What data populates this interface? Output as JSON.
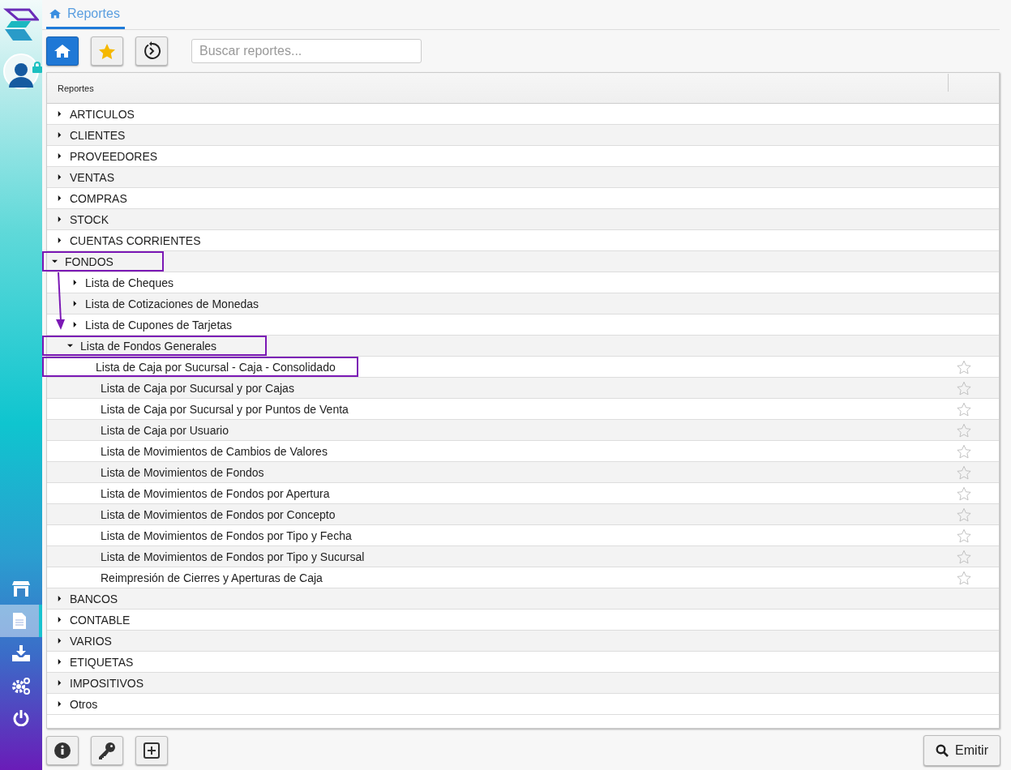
{
  "sidebar": {
    "items": [
      {
        "kind": "store",
        "selected": false
      },
      {
        "kind": "document",
        "selected": true
      },
      {
        "kind": "download",
        "selected": false
      },
      {
        "kind": "gears",
        "selected": false
      },
      {
        "kind": "power",
        "selected": false
      }
    ]
  },
  "tabs": [
    {
      "label": "Reportes",
      "selected": true
    }
  ],
  "toolbar": {
    "buttons": [
      {
        "kind": "home",
        "selected": true
      },
      {
        "kind": "star",
        "selected": false
      },
      {
        "kind": "history",
        "selected": false
      }
    ],
    "search": {
      "placeholder": "Buscar reportes..."
    }
  },
  "table": {
    "columns": [
      "Reportes"
    ],
    "annotation_arrow": true,
    "rows": [
      {
        "label": "ARTICULOS",
        "expanded": false,
        "highlighted": false
      },
      {
        "label": "CLIENTES",
        "expanded": false,
        "highlighted": false
      },
      {
        "label": "PROVEEDORES",
        "expanded": false,
        "highlighted": false
      },
      {
        "label": "VENTAS",
        "expanded": false,
        "highlighted": false
      },
      {
        "label": "COMPRAS",
        "expanded": false,
        "highlighted": false
      },
      {
        "label": "STOCK",
        "expanded": false,
        "highlighted": false
      },
      {
        "label": "CUENTAS CORRIENTES",
        "expanded": false,
        "highlighted": false
      },
      {
        "label": "FONDOS",
        "expanded": true,
        "highlighted": true,
        "children": [
          {
            "label": "Lista de Cheques",
            "expanded": false,
            "highlighted": false
          },
          {
            "label": "Lista de Cotizaciones de Monedas",
            "expanded": false,
            "highlighted": false
          },
          {
            "label": "Lista de Cupones de Tarjetas",
            "expanded": false,
            "highlighted": false
          },
          {
            "label": "Lista de Fondos Generales",
            "expanded": true,
            "highlighted": true,
            "children": [
              {
                "label": "Lista de Caja por Sucursal - Caja - Consolidado",
                "favorite": false,
                "highlighted": true
              },
              {
                "label": "Lista de Caja por Sucursal y por Cajas",
                "favorite": false,
                "highlighted": false
              },
              {
                "label": "Lista de Caja por Sucursal y por Puntos de Venta",
                "favorite": false,
                "highlighted": false
              },
              {
                "label": "Lista de Caja por Usuario",
                "favorite": false,
                "highlighted": false
              },
              {
                "label": "Lista de Movimientos de Cambios de Valores",
                "favorite": false,
                "highlighted": false
              },
              {
                "label": "Lista de Movimientos de Fondos",
                "favorite": false,
                "highlighted": false
              },
              {
                "label": "Lista de Movimientos de Fondos por Apertura",
                "favorite": false,
                "highlighted": false
              },
              {
                "label": "Lista de Movimientos de Fondos por Concepto",
                "favorite": false,
                "highlighted": false
              },
              {
                "label": "Lista de Movimientos de Fondos por Tipo y Fecha",
                "favorite": false,
                "highlighted": false
              },
              {
                "label": "Lista de Movimientos de Fondos por Tipo y Sucursal",
                "favorite": false,
                "highlighted": false
              },
              {
                "label": "Reimpresión de Cierres y Aperturas de Caja",
                "favorite": false,
                "highlighted": false
              }
            ]
          }
        ]
      },
      {
        "label": "BANCOS",
        "expanded": false,
        "highlighted": false
      },
      {
        "label": "CONTABLE",
        "expanded": false,
        "highlighted": false
      },
      {
        "label": "VARIOS",
        "expanded": false,
        "highlighted": false
      },
      {
        "label": "ETIQUETAS",
        "expanded": false,
        "highlighted": false
      },
      {
        "label": "IMPOSITIVOS",
        "expanded": false,
        "highlighted": false
      },
      {
        "label": "Otros",
        "expanded": false,
        "highlighted": false
      }
    ]
  },
  "footer": {
    "buttons": [
      {
        "kind": "info"
      },
      {
        "kind": "key"
      },
      {
        "kind": "add"
      }
    ],
    "emit_button": {
      "label": "Emitir"
    }
  }
}
